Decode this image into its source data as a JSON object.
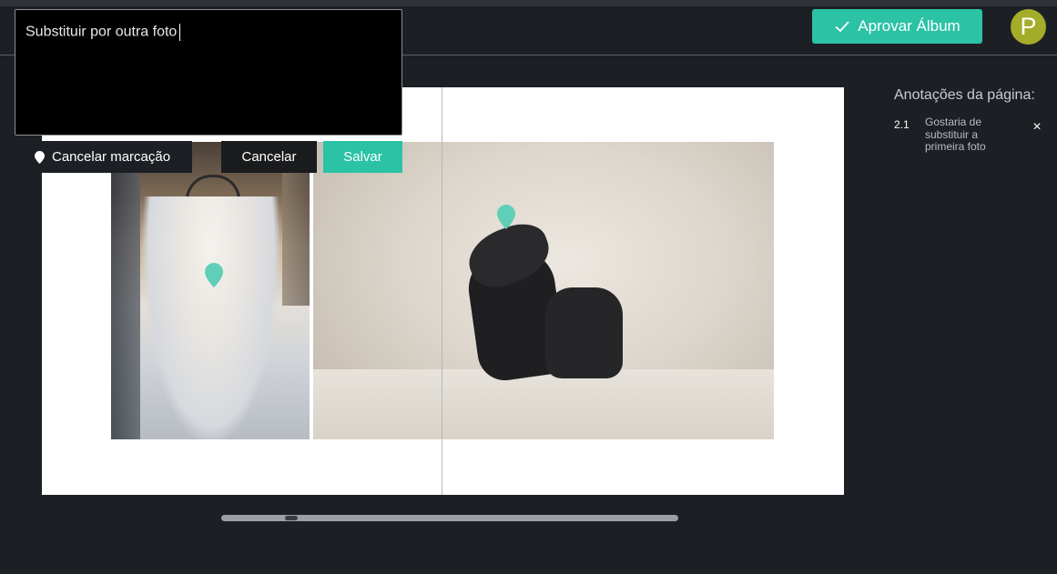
{
  "header": {
    "approve_label": "Aprovar Álbum",
    "avatar_initial": "P"
  },
  "editor": {
    "comment_text": "Substituir por outra foto",
    "cancel_mark_label": "Cancelar marcação",
    "cancel_label": "Cancelar",
    "save_label": "Salvar"
  },
  "notes": {
    "title": "Anotações da página:",
    "items": [
      {
        "number": "2.1",
        "text": "Gostaria de substituir a primeira foto",
        "close": "×"
      }
    ]
  },
  "colors": {
    "accent": "#2bc2a6",
    "avatar": "#a3ad2a",
    "background": "#1c1f24"
  }
}
